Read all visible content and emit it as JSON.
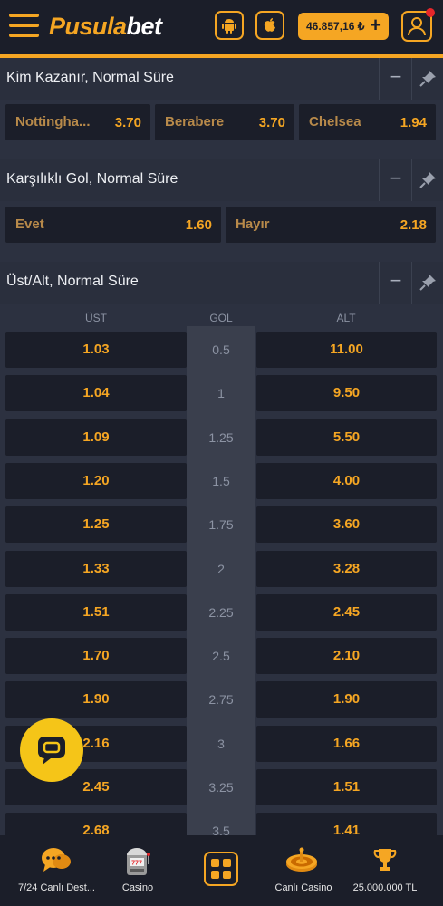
{
  "header": {
    "logo_part1": "Pusula",
    "logo_part2": "bet",
    "balance": "46.857,16 ₺",
    "plus": "+"
  },
  "markets": {
    "winner": {
      "title": "Kim Kazanır, Normal Süre",
      "minimize": "−",
      "options": [
        {
          "label": "Nottingha...",
          "odd": "3.70"
        },
        {
          "label": "Berabere",
          "odd": "3.70"
        },
        {
          "label": "Chelsea",
          "odd": "1.94"
        }
      ]
    },
    "btts": {
      "title": "Karşılıklı Gol, Normal Süre",
      "minimize": "−",
      "options": [
        {
          "label": "Evet",
          "odd": "1.60"
        },
        {
          "label": "Hayır",
          "odd": "2.18"
        }
      ]
    },
    "overunder": {
      "title": "Üst/Alt, Normal Süre",
      "minimize": "−",
      "col_over": "ÜST",
      "col_goal": "GOL",
      "col_under": "ALT",
      "rows": [
        {
          "over": "1.03",
          "goal": "0.5",
          "under": "11.00"
        },
        {
          "over": "1.04",
          "goal": "1",
          "under": "9.50"
        },
        {
          "over": "1.09",
          "goal": "1.25",
          "under": "5.50"
        },
        {
          "over": "1.20",
          "goal": "1.5",
          "under": "4.00"
        },
        {
          "over": "1.25",
          "goal": "1.75",
          "under": "3.60"
        },
        {
          "over": "1.33",
          "goal": "2",
          "under": "3.28"
        },
        {
          "over": "1.51",
          "goal": "2.25",
          "under": "2.45"
        },
        {
          "over": "1.70",
          "goal": "2.5",
          "under": "2.10"
        },
        {
          "over": "1.90",
          "goal": "2.75",
          "under": "1.90"
        },
        {
          "over": "2.16",
          "goal": "3",
          "under": "1.66"
        },
        {
          "over": "2.45",
          "goal": "3.25",
          "under": "1.51"
        },
        {
          "over": "2.68",
          "goal": "3.5",
          "under": "1.41"
        }
      ]
    }
  },
  "bottom_nav": {
    "support": "7/24 Canlı Dest...",
    "casino": "Casino",
    "live_casino": "Canlı Casino",
    "jackpot": "25.000.000 TL"
  },
  "colors": {
    "accent": "#f5a623",
    "header_bg": "#1b1e29",
    "page_bg": "#2c3140",
    "odd_bg": "#1b1e29",
    "chat_bg": "#f5c518"
  }
}
